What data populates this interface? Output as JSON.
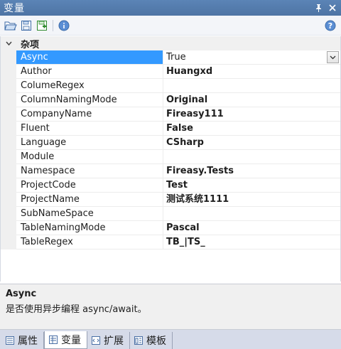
{
  "window": {
    "title": "变量"
  },
  "titlebar_buttons": [
    {
      "name": "pin-icon",
      "glyph": "📌"
    },
    {
      "name": "close-icon",
      "glyph": "✕"
    }
  ],
  "toolbar": {
    "items": [
      "open-folder-icon",
      "save-icon",
      "save-as-icon",
      "info-icon"
    ],
    "help": "help-icon"
  },
  "grid": {
    "category": {
      "label": "杂项",
      "expanded": true
    },
    "selected_index": 0,
    "rows": [
      {
        "name": "Async",
        "value": "True"
      },
      {
        "name": "Author",
        "value": "Huangxd"
      },
      {
        "name": "ColumeRegex",
        "value": ""
      },
      {
        "name": "ColumnNamingMode",
        "value": "Original"
      },
      {
        "name": "CompanyName",
        "value": "Fireasy111"
      },
      {
        "name": "Fluent",
        "value": "False"
      },
      {
        "name": "Language",
        "value": "CSharp"
      },
      {
        "name": "Module",
        "value": ""
      },
      {
        "name": "Namespace",
        "value": "Fireasy.Tests"
      },
      {
        "name": "ProjectCode",
        "value": "Test"
      },
      {
        "name": "ProjectName",
        "value": "测试系统1111"
      },
      {
        "name": "SubNameSpace",
        "value": ""
      },
      {
        "name": "TableNamingMode",
        "value": "Pascal"
      },
      {
        "name": "TableRegex",
        "value": "TB_|TS_"
      }
    ]
  },
  "description": {
    "title": "Async",
    "text": "是否使用异步编程 async/await。"
  },
  "tabs": [
    {
      "label": "属性",
      "icon": "properties-icon",
      "active": false
    },
    {
      "label": "变量",
      "icon": "variables-icon",
      "active": true
    },
    {
      "label": "扩展",
      "icon": "extension-icon",
      "active": false
    },
    {
      "label": "模板",
      "icon": "template-icon",
      "active": false
    }
  ],
  "colors": {
    "titlebar": "#5079ab",
    "selection": "#3399ff",
    "tabstrip": "#d6dbe9"
  }
}
